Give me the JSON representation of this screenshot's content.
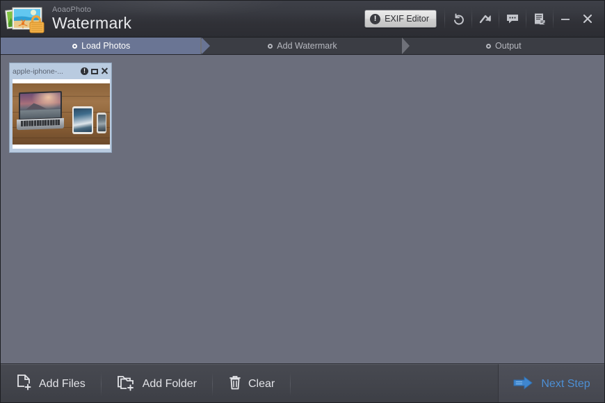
{
  "window": {
    "brand_top": "AoaoPhoto",
    "brand_main": "Watermark",
    "logo_icon": "photo-lock-logo",
    "accent_blue": "#4d8fd4",
    "step_active_bg": "#6a7594",
    "titlebar_bg": "#35363d",
    "canvas_bg": "#6b6e7c"
  },
  "toolbar": {
    "exif_label": "EXIF Editor",
    "exif_badge": "!",
    "icons": [
      {
        "name": "undo-icon",
        "title": "Undo"
      },
      {
        "name": "redo-arrow-icon",
        "title": "Redo"
      },
      {
        "name": "feedback-bubble-icon",
        "title": "Feedback"
      },
      {
        "name": "register-document-icon",
        "title": "Register"
      }
    ],
    "minimize_label": "–",
    "close_label": "✕"
  },
  "steps": [
    {
      "label": "Load Photos",
      "active": true
    },
    {
      "label": "Add Watermark",
      "active": false
    },
    {
      "label": "Output",
      "active": false
    }
  ],
  "photos": [
    {
      "name": "apple-iphone-...",
      "info_icon": "info-icon",
      "maximize_icon": "maximize-icon",
      "close_icon": "close-icon",
      "image_alt": "macbook-ipad-iphone-on-wooden-desk"
    }
  ],
  "bottom": {
    "add_files_label": "Add Files",
    "add_files_icon": "file-add-icon",
    "add_folder_label": "Add Folder",
    "add_folder_icon": "folder-add-icon",
    "clear_label": "Clear",
    "clear_icon": "trash-icon",
    "next_step_label": "Next Step",
    "next_step_icon": "arrow-right-icon"
  }
}
